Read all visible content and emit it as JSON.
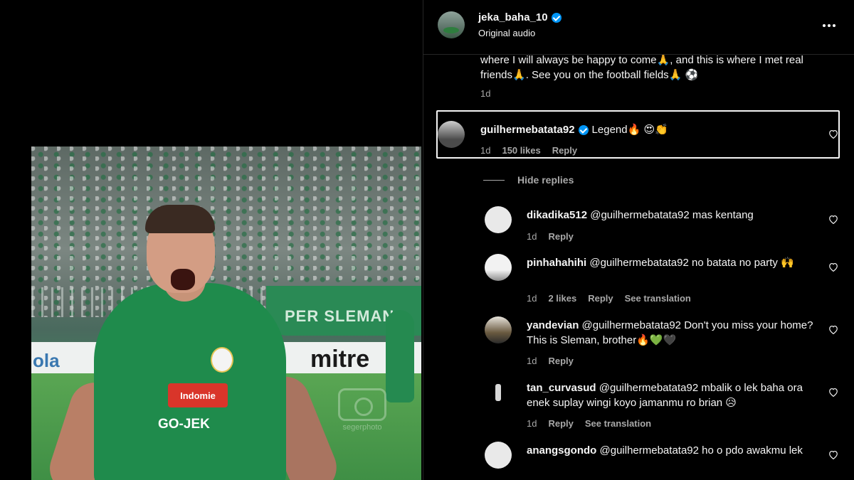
{
  "media": {
    "banner_text": "PER SLEMAN",
    "board_text": "mitre",
    "board_left": "ola",
    "sponsor1": "Indomie",
    "sponsor2": "GO-JEK",
    "watermark": "segerphoto"
  },
  "header": {
    "username": "jeka_baha_10",
    "subtitle": "Original audio",
    "verified": true
  },
  "caption": {
    "lines": "where I will always be happy to come🙏, and this is where I met real friends🙏. See you on the football fields🙏 ⚽",
    "time": "1d"
  },
  "highlighted_comment": {
    "username": "guilhermebatata92",
    "verified": true,
    "text": "Legend🔥 😍👏",
    "time": "1d",
    "likes": "150 likes",
    "reply": "Reply"
  },
  "hide_replies_label": "Hide replies",
  "replies": [
    {
      "username": "dikadika512",
      "text": "@guilhermebatata92 mas kentang",
      "time": "1d",
      "likes": "",
      "reply": "Reply",
      "translate": ""
    },
    {
      "username": "pinhahahihi",
      "text": "@guilhermebatata92 no batata no party 🙌",
      "time": "1d",
      "likes": "2 likes",
      "reply": "Reply",
      "translate": "See translation"
    },
    {
      "username": "yandevian",
      "text": "@guilhermebatata92 Don't you miss your home? This is Sleman, brother🔥💚🖤",
      "time": "1d",
      "likes": "",
      "reply": "Reply",
      "translate": ""
    },
    {
      "username": "tan_curvasud",
      "text": "@guilhermebatata92 mbalik o lek baha ora enek suplay wingi koyo jamanmu ro brian 😥",
      "time": "1d",
      "likes": "",
      "reply": "Reply",
      "translate": "See translation"
    },
    {
      "username": "anangsgondo",
      "text": "@guilhermebatata92 ho o pdo awakmu lek",
      "time": "",
      "likes": "",
      "reply": "",
      "translate": ""
    }
  ]
}
